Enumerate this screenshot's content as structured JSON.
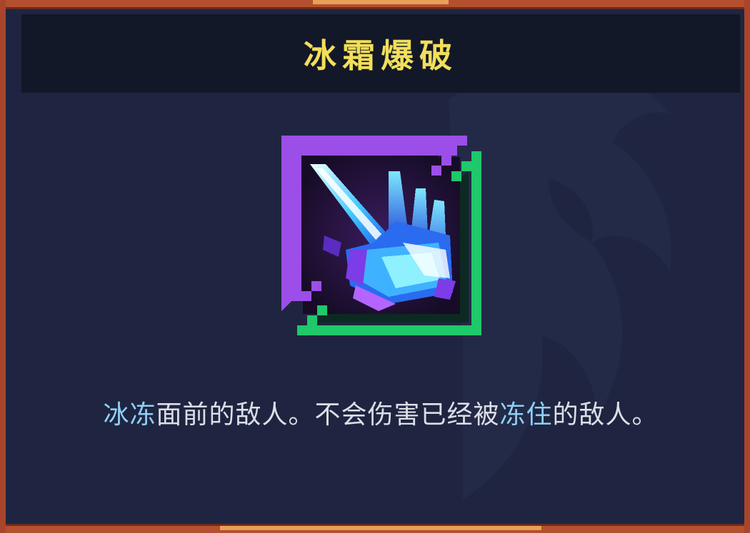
{
  "card": {
    "title": "冰霜爆破",
    "icon": "frost-blast-icon",
    "description": [
      {
        "text": "冰冻",
        "keyword": true
      },
      {
        "text": "面前的敌人。不会伤害已经被",
        "keyword": false
      },
      {
        "text": "冻住",
        "keyword": true
      },
      {
        "text": "的敌人。",
        "keyword": false
      }
    ]
  },
  "colors": {
    "title": "#f2de5a",
    "keyword": "#8fd0f5",
    "text": "#dcdfe8",
    "panel": "#1f2540",
    "title_bar": "#121828",
    "frame": "#a8452c",
    "icon_border_primary": "#9b4ee8",
    "icon_border_secondary": "#1fc86a"
  }
}
